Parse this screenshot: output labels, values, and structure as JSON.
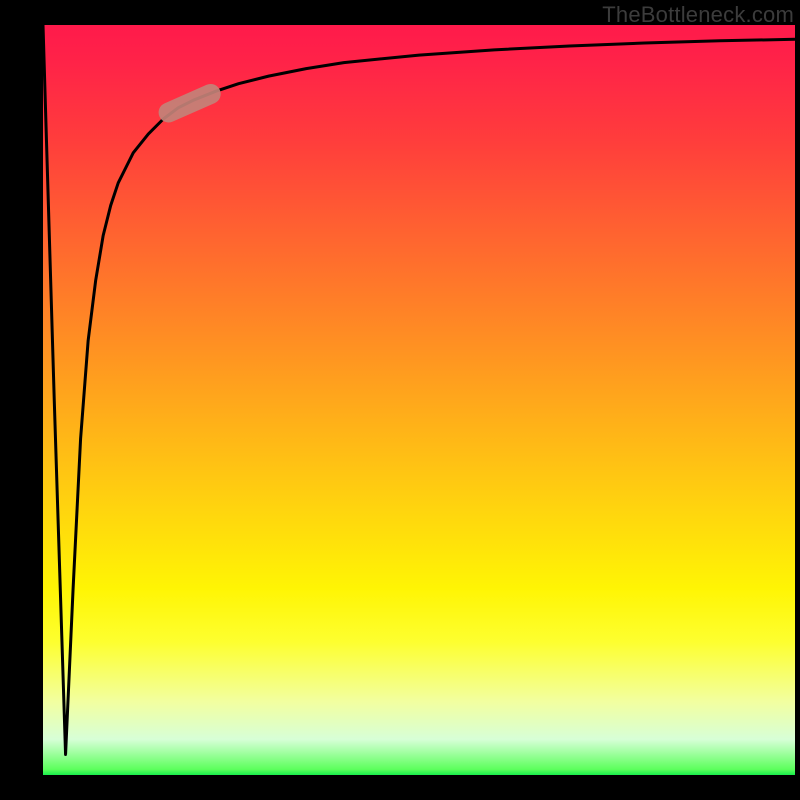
{
  "attribution": "TheBottleneck.com",
  "colors": {
    "background": "#000000",
    "gradient_top": "#ff1a4b",
    "gradient_mid": "#fff504",
    "gradient_bottom": "#00e846",
    "curve": "#000000",
    "highlight": "#c38278"
  },
  "chart_data": {
    "type": "line",
    "title": "",
    "xlabel": "",
    "ylabel": "",
    "xlim": [
      0,
      100
    ],
    "ylim": [
      0,
      100
    ],
    "grid": false,
    "legend": false,
    "series": [
      {
        "name": "bottleneck-curve",
        "x": [
          0,
          1.5,
          3,
          4,
          5,
          6,
          7,
          8,
          9,
          10,
          12,
          14,
          16,
          18,
          20,
          23,
          26,
          30,
          35,
          40,
          50,
          60,
          70,
          80,
          90,
          100
        ],
        "y": [
          100,
          50,
          3,
          25,
          45,
          58,
          66,
          72,
          76,
          79,
          83,
          85.5,
          87.5,
          89,
          90,
          91.2,
          92.2,
          93.2,
          94.2,
          95,
          96,
          96.7,
          97.2,
          97.6,
          97.9,
          98.1
        ]
      }
    ],
    "annotations": [
      {
        "name": "highlight-pill",
        "type": "marker",
        "x_center": 19.5,
        "y_center": 89.6,
        "shape": "rounded-rect",
        "approx_length_x": 8,
        "approx_length_y": 3
      }
    ]
  }
}
